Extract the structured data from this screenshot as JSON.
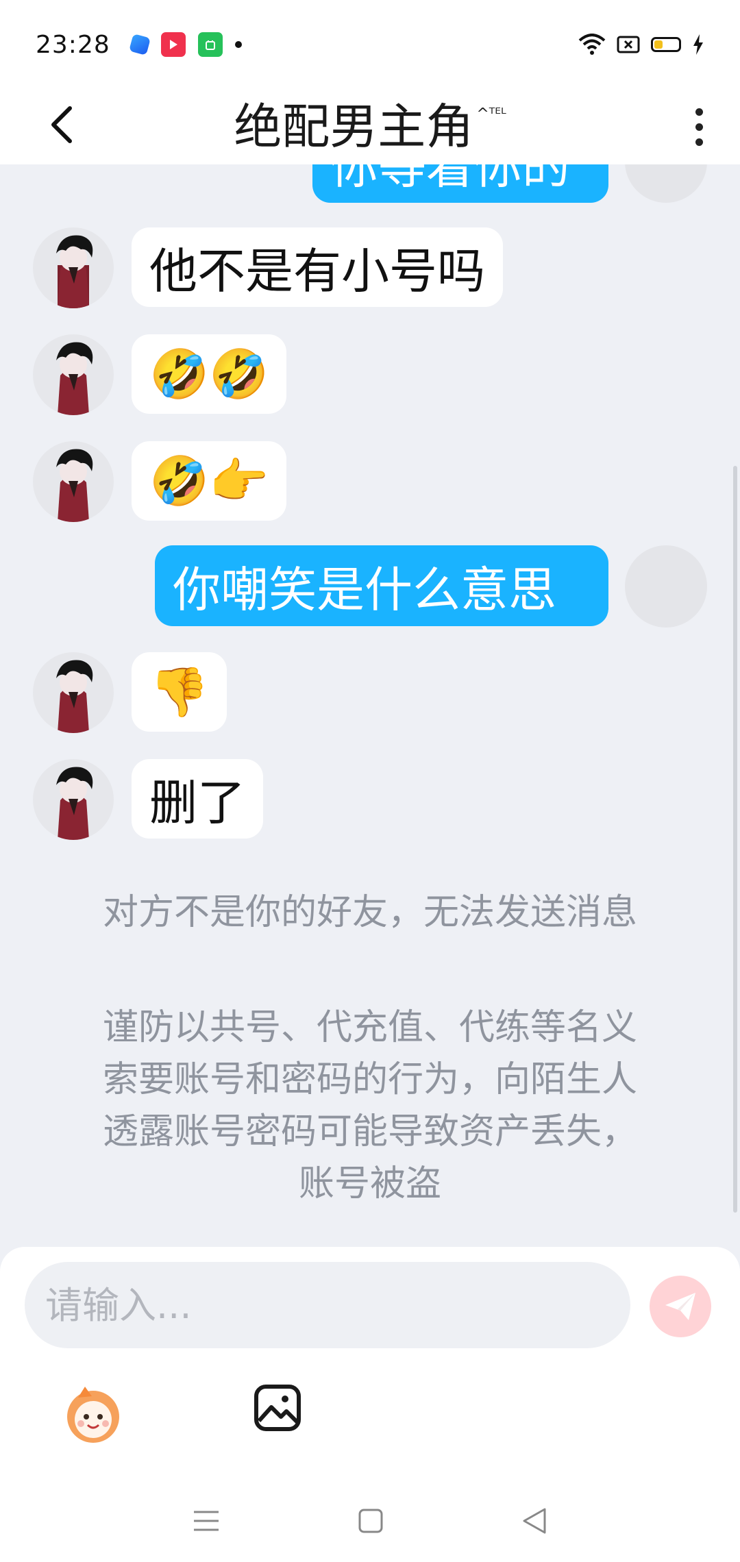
{
  "status_bar": {
    "time": "23:28"
  },
  "header": {
    "title": "绝配男主角",
    "title_badge": "^ᵀᴱᴸ"
  },
  "messages": [
    {
      "side": "out",
      "text": "你等着你的"
    },
    {
      "side": "in",
      "text": "他不是有小号吗"
    },
    {
      "side": "in",
      "text": "🤣🤣"
    },
    {
      "side": "in",
      "text": "🤣👉"
    },
    {
      "side": "out",
      "text": "你嘲笑是什么意思"
    },
    {
      "side": "in",
      "text": "👎"
    },
    {
      "side": "in",
      "text": "删了"
    }
  ],
  "system_notes": {
    "not_friend": "对方不是你的好友，无法发送消息",
    "warning_line1": "谨防以共号、代充值、代练等名义",
    "warning_line2": "索要账号和密码的行为，向陌生人",
    "warning_line3": "透露账号密码可能导致资产丢失，",
    "warning_line4": "账号被盗"
  },
  "input": {
    "placeholder": "请输入..."
  },
  "colors": {
    "outgoing_bubble": "#1ab3ff",
    "send_button": "#ffd3d6",
    "background": "#eef0f5"
  }
}
